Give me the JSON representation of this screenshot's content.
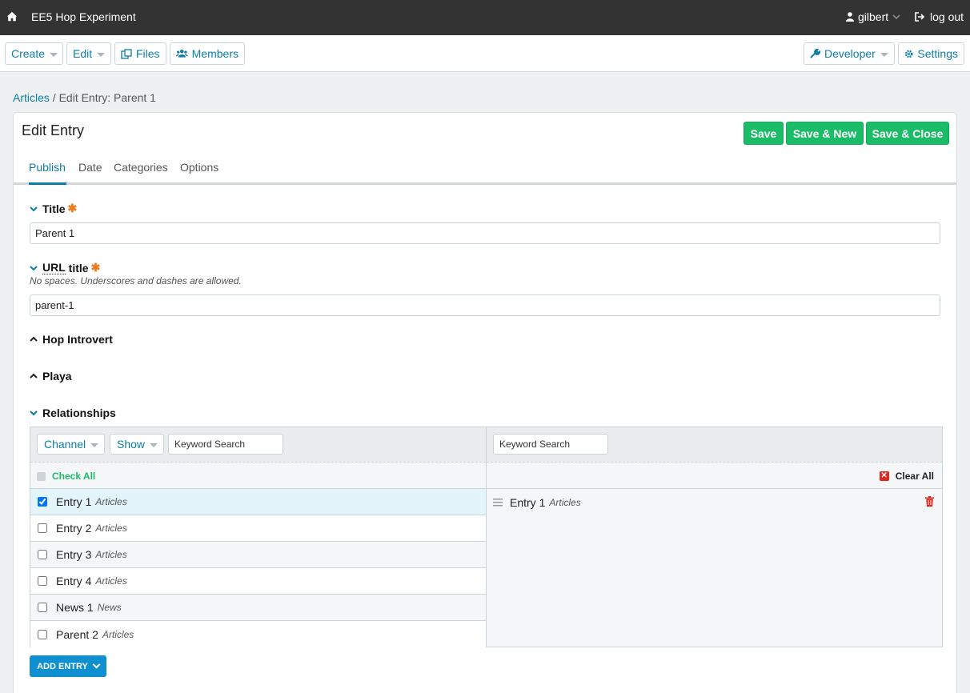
{
  "topbar": {
    "site_name": "EE5 Hop Experiment",
    "username": "gilbert",
    "logout_label": "log out"
  },
  "nav": {
    "create": "Create",
    "edit": "Edit",
    "files": "Files",
    "members": "Members",
    "developer": "Developer",
    "settings": "Settings"
  },
  "breadcrumb": {
    "parent": "Articles",
    "separator": "/",
    "current": "Edit Entry: Parent 1"
  },
  "page": {
    "title": "Edit Entry",
    "save": "Save",
    "save_new": "Save & New",
    "save_close": "Save & Close"
  },
  "tabs": [
    "Publish",
    "Date",
    "Categories",
    "Options"
  ],
  "active_tab": "Publish",
  "fields": {
    "title": {
      "label": "Title",
      "required": "✱",
      "value": "Parent 1"
    },
    "url_title": {
      "label_abbr": "URL",
      "label_rest": " title",
      "required": "✱",
      "hint": "No spaces. Underscores and dashes are allowed.",
      "value": "parent-1"
    },
    "hop_introvert": {
      "label": "Hop Introvert"
    },
    "playa": {
      "label": "Playa"
    },
    "relationships": {
      "label": "Relationships"
    }
  },
  "relationships": {
    "channel_filter": "Channel",
    "show_filter": "Show",
    "search_placeholder": "Keyword Search",
    "check_all": "Check All",
    "clear_all": "Clear All",
    "entries": [
      {
        "title": "Entry 1",
        "channel": "Articles",
        "checked": true
      },
      {
        "title": "Entry 2",
        "channel": "Articles",
        "checked": false
      },
      {
        "title": "Entry 3",
        "channel": "Articles",
        "checked": false
      },
      {
        "title": "Entry 4",
        "channel": "Articles",
        "checked": false
      },
      {
        "title": "News 1",
        "channel": "News",
        "checked": false
      },
      {
        "title": "Parent 2",
        "channel": "Articles",
        "checked": false
      }
    ],
    "selected": [
      {
        "title": "Entry 1",
        "channel": "Articles"
      }
    ],
    "add_entry": "ADD ENTRY"
  },
  "colors": {
    "accent": "#0d7ea8",
    "save_green": "#1bbc68",
    "required": "#f07a1a",
    "topbar": "#333333"
  }
}
